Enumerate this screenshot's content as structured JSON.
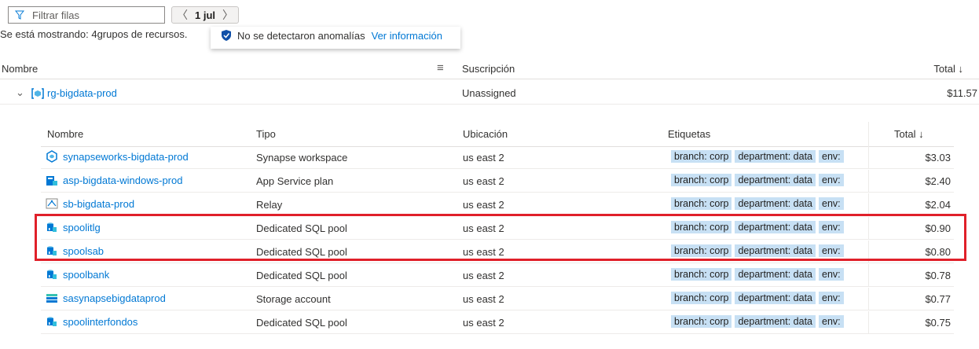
{
  "toolbar": {
    "filter_placeholder": "Filtrar filas",
    "date": "1 jul",
    "prev_arrow": "〈",
    "next_arrow": "〉"
  },
  "status": {
    "showing_text": "Se está mostrando: 4grupos de recursos.",
    "anomaly_text": "No se detectaron anomalías",
    "anomaly_link": "Ver información"
  },
  "outer_table": {
    "headers": {
      "name": "Nombre",
      "subscription": "Suscripción",
      "total": "Total ↓"
    },
    "row": {
      "name": "rg-bigdata-prod",
      "subscription": "Unassigned",
      "total": "$11.57"
    }
  },
  "inner_table": {
    "headers": {
      "name": "Nombre",
      "type": "Tipo",
      "location": "Ubicación",
      "tags": "Etiquetas",
      "total": "Total ↓"
    },
    "rows": [
      {
        "name": "synapseworks-bigdata-prod",
        "type": "Synapse workspace",
        "location": "us east 2",
        "total": "$3.03",
        "icon": "synapse-icon"
      },
      {
        "name": "asp-bigdata-windows-prod",
        "type": "App Service plan",
        "location": "us east 2",
        "total": "$2.40",
        "icon": "app-service-plan-icon"
      },
      {
        "name": "sb-bigdata-prod",
        "type": "Relay",
        "location": "us east 2",
        "total": "$2.04",
        "icon": "relay-icon"
      },
      {
        "name": "spoolitlg",
        "type": "Dedicated SQL pool",
        "location": "us east 2",
        "total": "$0.90",
        "icon": "sql-pool-icon"
      },
      {
        "name": "spoolsab",
        "type": "Dedicated SQL pool",
        "location": "us east 2",
        "total": "$0.80",
        "icon": "sql-pool-icon"
      },
      {
        "name": "spoolbank",
        "type": "Dedicated SQL pool",
        "location": "us east 2",
        "total": "$0.78",
        "icon": "sql-pool-icon"
      },
      {
        "name": "sasynapsebigdataprod",
        "type": "Storage account",
        "location": "us east 2",
        "total": "$0.77",
        "icon": "storage-account-icon"
      },
      {
        "name": "spoolinterfondos",
        "type": "Dedicated SQL pool",
        "location": "us east 2",
        "total": "$0.75",
        "icon": "sql-pool-icon"
      }
    ],
    "tags": {
      "t1": "branch: corp",
      "t2": "department: data",
      "t3": "env:"
    }
  },
  "colors": {
    "link": "#0078d4",
    "tag_bg": "#c7e0f4",
    "highlight": "#e0202a"
  }
}
